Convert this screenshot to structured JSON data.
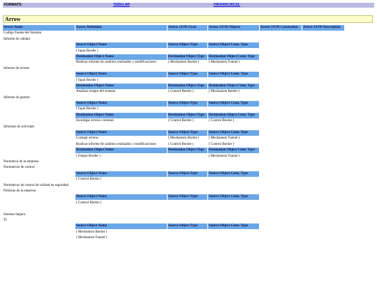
{
  "formats": {
    "label": "FORMATS:",
    "tabular": "TABULAR",
    "hierarchical": "HIERARCHICAL"
  },
  "title": "Arrow",
  "columns": [
    "Arrow Name",
    "Arrow Definition",
    "Arrow UOW Facts",
    "Arrow UOW Objects",
    "Arrow UOW Constraints",
    "Arrow UOW Description"
  ],
  "sub_headers": {
    "source_object_name": "Source Object Name",
    "source_object_type": "Source Object Type",
    "source_object_conn_type": "Source Object Conn. Type",
    "destination_object_name": "Destination Object Name",
    "destination_object_type": "Destination Object Type",
    "destination_object_conn_type": "Destination Object Conn. Type"
  },
  "rows": {
    "codigo_fuente": "Codigo Fuente del Sistema",
    "informe_calidad": "Informe de calidad",
    "ic_src_type": "( Input Border )",
    "ic_dst_name": "Realizar informe  de cambios  realizados y modificaciones",
    "ic_dst_type": "( Mechanism Border )",
    "ic_dst_conn": "( Mechanism Tunnel )",
    "informe_errores": "Informe de errores",
    "ie_src_type": "( Input Border )",
    "ie_dst_name": "Analizar riesgos  del sistema",
    "ie_dst_type": "( Control Border )",
    "ie_dst_conn": "( Mechanism Border )",
    "informe_gestion": "Informe de gestion",
    "ig_src_type": "( Input Border )",
    "ig_dst_name": "Investigar errores comunes",
    "ig_dst_type": "( Control Border )",
    "ig_dst_conn": "( Control Border )",
    "informes_actividad": "Informes de actividad",
    "ia_src_name": "Corregir errores",
    "ia_src_type": "( Mechanism Border )",
    "ia_src_conn": "( Mechanism Tunnel )",
    "ia_src_name2": "Realizar informe  de cambios  realizados y modificaciones",
    "ia_src_type2": "( Control Border )",
    "ia_src_conn2": "( Control Border )",
    "ia_dst_type": "( Output Border )",
    "ia_dst_conn": "( Mechanism Tunnel )",
    "normativa_empresa": "Normativa de la empresa",
    "normativas_control": "Normativas de control",
    "nc_src_type": "( Control Border )",
    "normativas_calidad": "Normativas de control de calidad en seguridad",
    "politicas_empresa": "Politicas de la empresa",
    "pe_src_type": "( Control Border )",
    "sistema_seguro": "Sistema Seguro",
    "ti": "TI",
    "ti_src_type": "( Mechanism Border )",
    "ti_src_type2": "( Mechanism Tunnel )"
  }
}
